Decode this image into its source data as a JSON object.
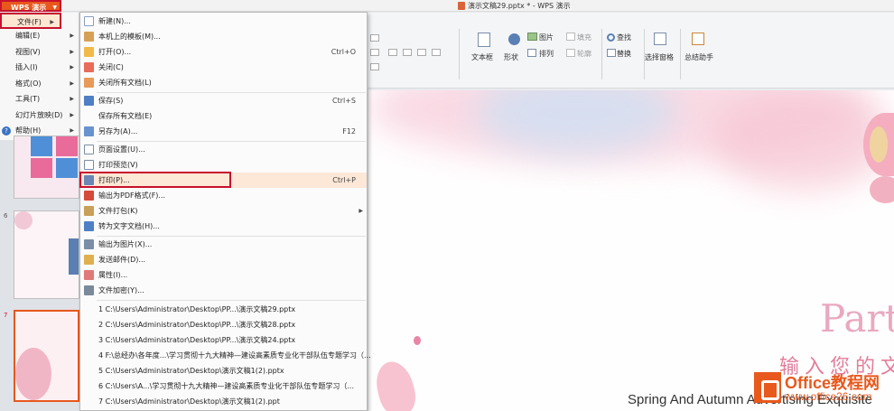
{
  "app": {
    "menu_button": "WPS 演示",
    "doc_title": "演示文稿29.pptx * - WPS 演示"
  },
  "left_menu": [
    {
      "label": "文件(F)",
      "active": true
    },
    {
      "label": "编辑(E)"
    },
    {
      "label": "视图(V)"
    },
    {
      "label": "插入(I)"
    },
    {
      "label": "格式(O)"
    },
    {
      "label": "工具(T)"
    },
    {
      "label": "幻灯片放映(D)"
    },
    {
      "label": "帮助(H)"
    }
  ],
  "file_menu": {
    "items": [
      {
        "label": "新建(N)...",
        "shortcut": "",
        "icon": "new-icon"
      },
      {
        "label": "本机上的模板(M)...",
        "shortcut": "",
        "icon": "template-icon"
      },
      {
        "label": "打开(O)...",
        "shortcut": "Ctrl+O",
        "icon": "open-icon"
      },
      {
        "label": "关闭(C)",
        "shortcut": "",
        "icon": "close-doc-icon"
      },
      {
        "label": "关闭所有文档(L)",
        "shortcut": "",
        "icon": "close-all-icon"
      },
      {
        "label": "保存(S)",
        "shortcut": "Ctrl+S",
        "icon": "save-icon"
      },
      {
        "label": "保存所有文档(E)",
        "shortcut": "",
        "icon": ""
      },
      {
        "label": "另存为(A)...",
        "shortcut": "F12",
        "icon": "save-as-icon"
      },
      {
        "label": "页面设置(U)...",
        "shortcut": "",
        "icon": "page-setup-icon"
      },
      {
        "label": "打印预览(V)",
        "shortcut": "",
        "icon": "print-preview-icon"
      },
      {
        "label": "打印(P)...",
        "shortcut": "Ctrl+P",
        "icon": "print-icon"
      },
      {
        "label": "输出为PDF格式(F)...",
        "shortcut": "",
        "icon": "pdf-icon"
      },
      {
        "label": "文件打包(K)",
        "shortcut": "",
        "icon": "package-icon"
      },
      {
        "label": "转为文字文档(H)...",
        "shortcut": "",
        "icon": "convert-icon"
      },
      {
        "label": "输出为图片(X)...",
        "shortcut": "",
        "icon": "image-export-icon"
      },
      {
        "label": "发送邮件(D)...",
        "shortcut": "",
        "icon": "mail-icon"
      },
      {
        "label": "属性(I)...",
        "shortcut": "",
        "icon": "properties-icon"
      },
      {
        "label": "文件加密(Y)...",
        "shortcut": "",
        "icon": "encrypt-icon"
      }
    ],
    "recent": [
      "1 C:\\Users\\Administrator\\Desktop\\PP...\\演示文稿29.pptx",
      "2 C:\\Users\\Administrator\\Desktop\\PP...\\演示文稿28.pptx",
      "3 C:\\Users\\Administrator\\Desktop\\PP...\\演示文稿24.pptx",
      "4 F:\\总经办\\各年度...\\学习贯彻十九大精神—建设高素质专业化干部队伍专题学习（...",
      "5 C:\\Users\\Administrator\\Desktop\\演示文稿1(2).pptx",
      "6 C:\\Users\\A...\\学习贯彻十九大精神—建设高素质专业化干部队伍专题学习（...",
      "7 C:\\Users\\Administrator\\Desktop\\演示文稿1(2).ppt"
    ]
  },
  "toolbar": {
    "find": "查找",
    "replace": "替换",
    "picture": "图片",
    "fill": "填充",
    "textbox": "文本框",
    "shape": "形状",
    "arrange": "排列",
    "outline": "轮廓",
    "select_pane": "选择窗格",
    "summary": "总结助手"
  },
  "slide_panel": {
    "thumb6": "6",
    "thumb7": "7"
  },
  "slide": {
    "part_text": "Part",
    "cn_text": "输入您的文",
    "en_text": "Spring And Autumn Advertising Exquisite"
  },
  "logo": {
    "name": "Office教程网",
    "url": "www.office26.com"
  },
  "colors": {
    "accent": "#e8581d",
    "highlight_border": "#c8102e",
    "hover": "#fde7d6"
  }
}
